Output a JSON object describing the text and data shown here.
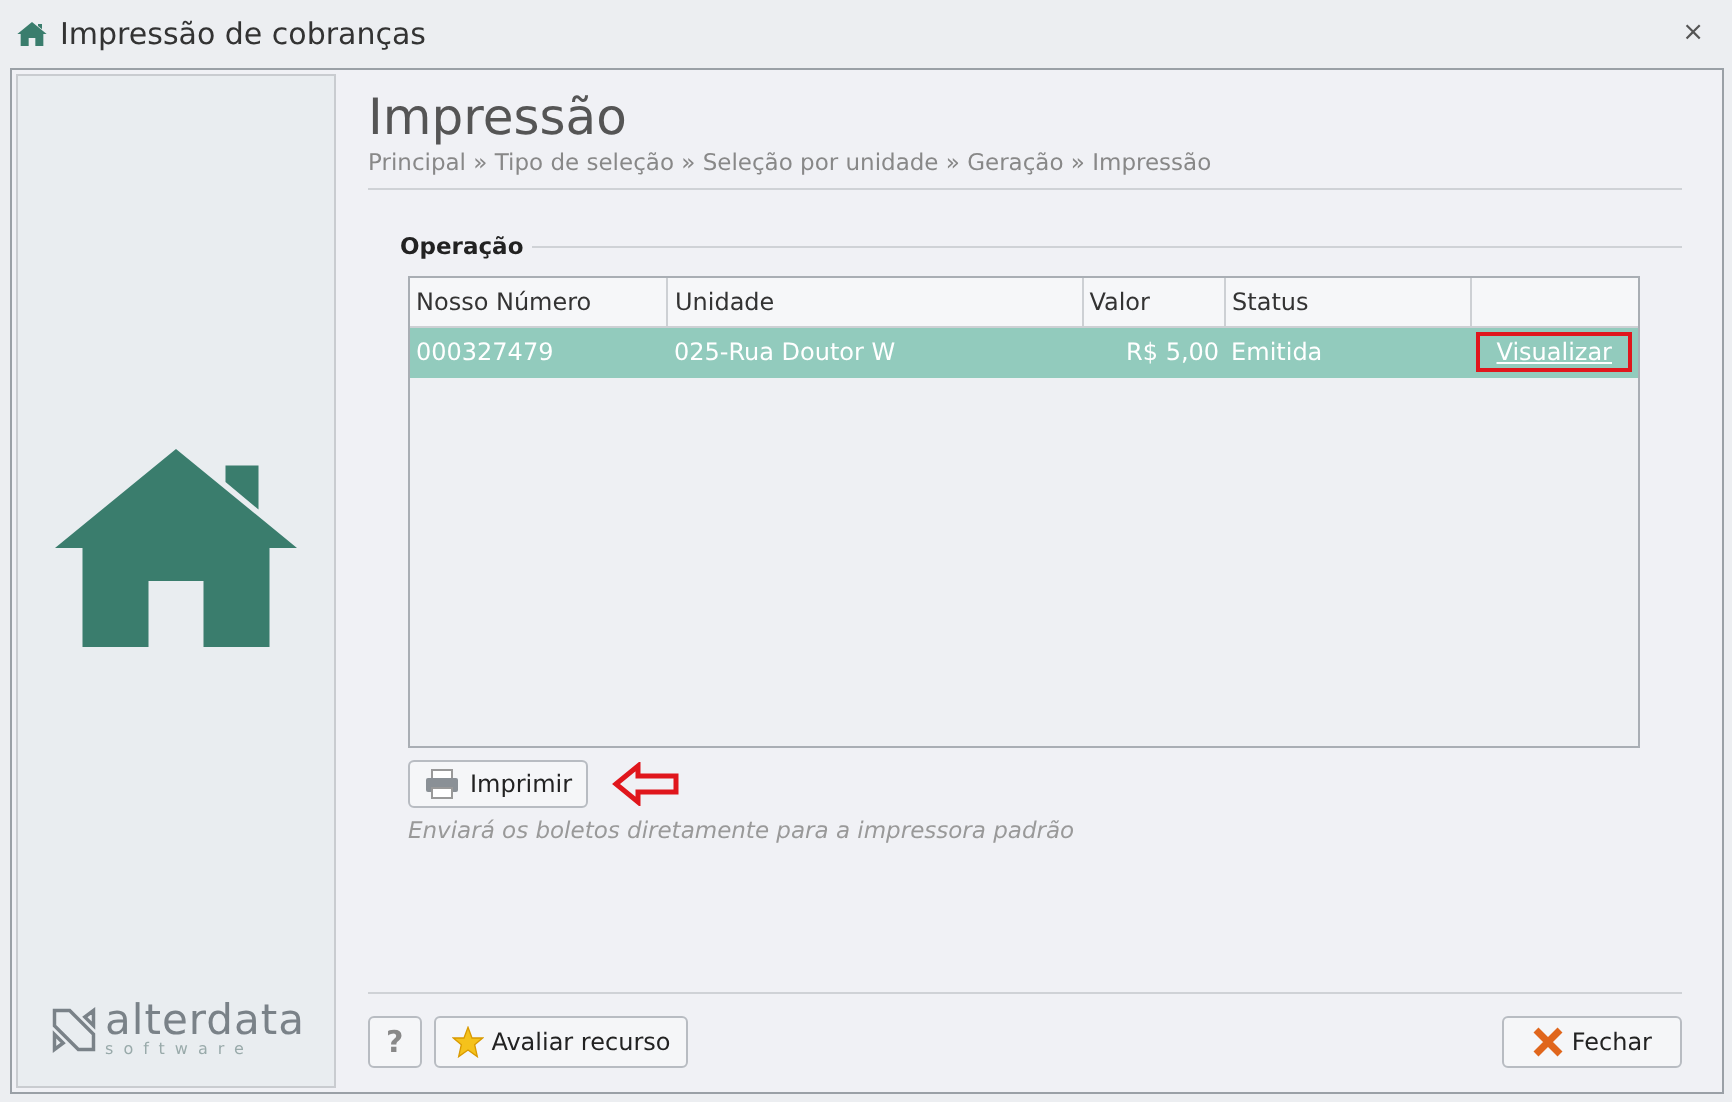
{
  "window": {
    "title": "Impressão de cobranças",
    "close": "⨯"
  },
  "sidebar": {
    "logo": {
      "name": "alterdata",
      "tagline": "software"
    }
  },
  "page": {
    "title": "Impressão",
    "breadcrumb": "Principal » Tipo de seleção » Seleção por unidade » Geração » Impressão"
  },
  "section": {
    "title": "Operação"
  },
  "table": {
    "columns": [
      "Nosso Número",
      "Unidade",
      "Valor",
      "Status"
    ],
    "rows": [
      {
        "nosso_numero": "000327479",
        "unidade": "025-Rua Doutor W",
        "valor": "R$ 5,00",
        "status": "Emitida",
        "link": "Visualizar",
        "selected": true,
        "highlighted_link": true
      }
    ]
  },
  "print_button": {
    "label": "Imprimir",
    "arrow_annotation": true
  },
  "hint": "Enviará os boletos diretamente para a impressora padrão",
  "footer": {
    "help": "?",
    "rate": "Avaliar recurso",
    "close": "Fechar"
  }
}
